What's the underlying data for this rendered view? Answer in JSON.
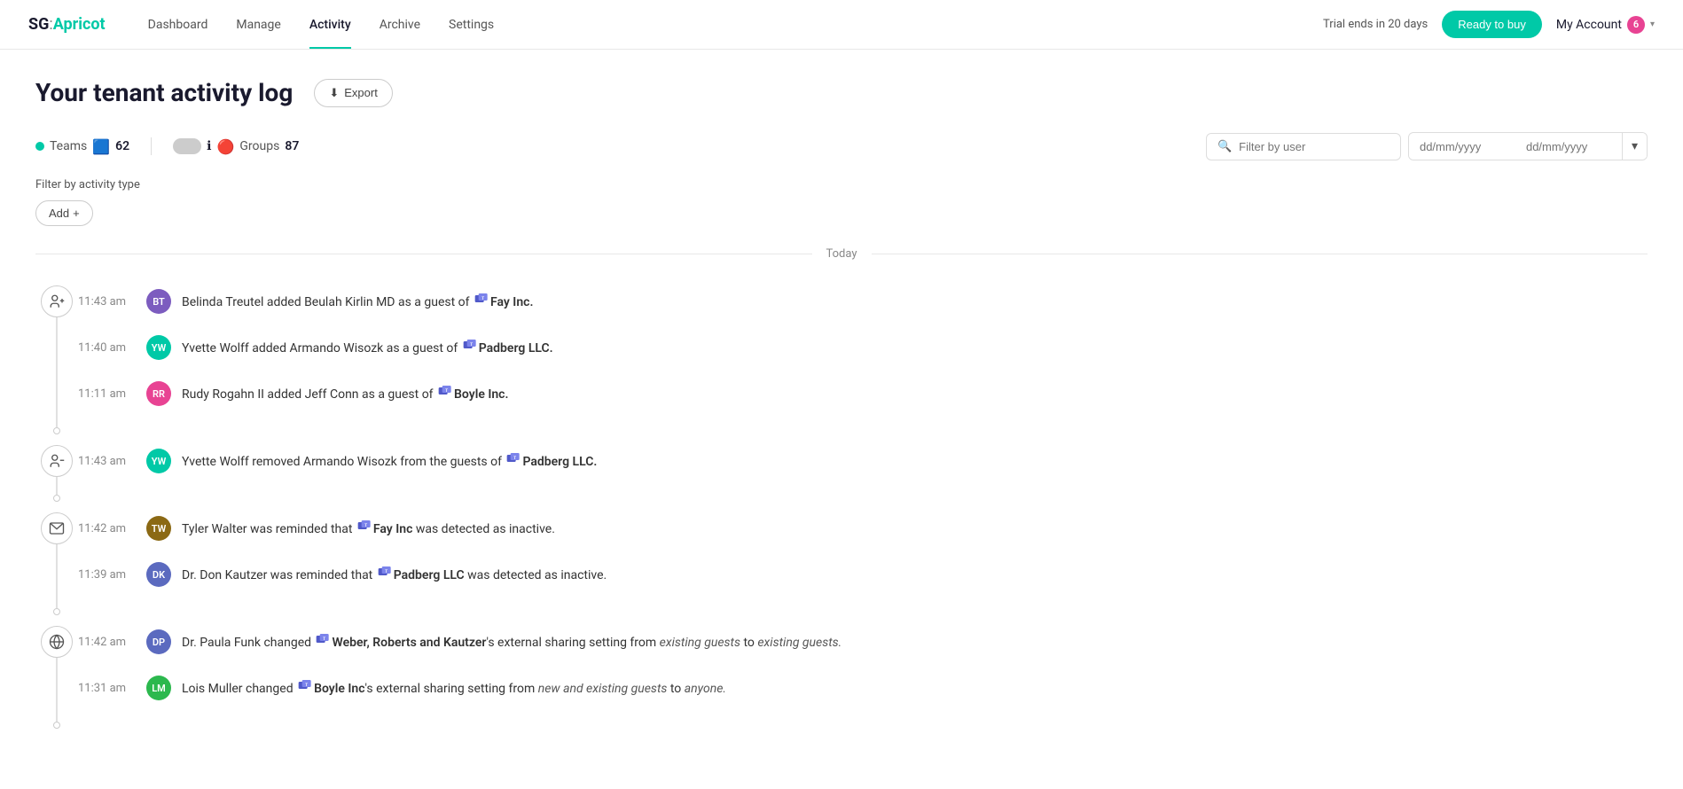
{
  "logo": {
    "sg": "SG",
    "colon": ":",
    "apricot": "Apricot"
  },
  "nav": {
    "links": [
      {
        "id": "dashboard",
        "label": "Dashboard",
        "active": false
      },
      {
        "id": "manage",
        "label": "Manage",
        "active": false
      },
      {
        "id": "activity",
        "label": "Activity",
        "active": true
      },
      {
        "id": "archive",
        "label": "Archive",
        "active": false
      },
      {
        "id": "settings",
        "label": "Settings",
        "active": false
      }
    ],
    "trial_text": "Trial ends in 20 days",
    "ready_btn": "Ready to buy",
    "my_account": "My Account",
    "account_badge": "6"
  },
  "page": {
    "title": "Your tenant activity log",
    "export_btn": "Export"
  },
  "filters": {
    "teams_label": "Teams",
    "teams_count": "62",
    "groups_label": "Groups",
    "groups_count": "87",
    "search_placeholder": "Filter by user",
    "date_from_placeholder": "dd/mm/yyyy",
    "date_to_placeholder": "dd/mm/yyyy"
  },
  "activity_filter": {
    "label": "Filter by activity type",
    "add_btn": "Add"
  },
  "today_label": "Today",
  "activity_groups": [
    {
      "type": "add-guest",
      "entries": [
        {
          "time": "11:43 am",
          "avatar_initials": "BT",
          "avatar_color": "#7c5cbf",
          "text_parts": [
            {
              "type": "plain",
              "text": "Belinda Treutel added Beulah Kirlin MD as a guest of "
            },
            {
              "type": "teams-icon"
            },
            {
              "type": "bold",
              "text": "Fay Inc."
            }
          ]
        },
        {
          "time": "11:40 am",
          "avatar_initials": "YW",
          "avatar_color": "#00c9a7",
          "text_parts": [
            {
              "type": "plain",
              "text": "Yvette Wolff added Armando Wisozk as a guest of "
            },
            {
              "type": "teams-icon"
            },
            {
              "type": "bold",
              "text": "Padberg LLC."
            }
          ]
        },
        {
          "time": "11:11 am",
          "avatar_initials": "RR",
          "avatar_color": "#e84393",
          "text_parts": [
            {
              "type": "plain",
              "text": "Rudy Rogahn II added Jeff Conn as a guest of "
            },
            {
              "type": "teams-icon"
            },
            {
              "type": "bold",
              "text": "Boyle Inc."
            }
          ]
        }
      ]
    },
    {
      "type": "remove-guest",
      "entries": [
        {
          "time": "11:43 am",
          "avatar_initials": "YW",
          "avatar_color": "#00c9a7",
          "text_parts": [
            {
              "type": "plain",
              "text": "Yvette Wolff removed Armando Wisozk from the guests of "
            },
            {
              "type": "teams-icon"
            },
            {
              "type": "bold",
              "text": "Padberg LLC."
            }
          ]
        }
      ]
    },
    {
      "type": "email",
      "entries": [
        {
          "time": "11:42 am",
          "avatar_initials": "TW",
          "avatar_color": "#8B6914",
          "avatar_img": true,
          "text_parts": [
            {
              "type": "plain",
              "text": "Tyler Walter was reminded that "
            },
            {
              "type": "teams-icon"
            },
            {
              "type": "bold",
              "text": "Fay Inc"
            },
            {
              "type": "plain",
              "text": " was detected as inactive."
            }
          ]
        },
        {
          "time": "11:39 am",
          "avatar_initials": "DK",
          "avatar_color": "#5b6abf",
          "text_parts": [
            {
              "type": "plain",
              "text": "Dr. Don Kautzer was reminded that "
            },
            {
              "type": "teams-icon"
            },
            {
              "type": "bold",
              "text": "Padberg LLC"
            },
            {
              "type": "plain",
              "text": " was detected as inactive."
            }
          ]
        }
      ]
    },
    {
      "type": "globe",
      "entries": [
        {
          "time": "11:42 am",
          "avatar_initials": "DP",
          "avatar_color": "#5b6abf",
          "text_parts": [
            {
              "type": "plain",
              "text": "Dr. Paula Funk changed "
            },
            {
              "type": "teams-icon"
            },
            {
              "type": "bold",
              "text": "Weber, Roberts and Kautzer"
            },
            {
              "type": "plain",
              "text": "'s external sharing setting from "
            },
            {
              "type": "italic",
              "text": "existing guests"
            },
            {
              "type": "plain",
              "text": " to "
            },
            {
              "type": "italic",
              "text": "existing guests."
            }
          ]
        },
        {
          "time": "11:31 am",
          "avatar_initials": "LM",
          "avatar_color": "#2cb84e",
          "text_parts": [
            {
              "type": "plain",
              "text": "Lois Muller changed "
            },
            {
              "type": "teams-icon"
            },
            {
              "type": "bold",
              "text": "Boyle Inc"
            },
            {
              "type": "italic2",
              "text": "'s external sharing setting from "
            },
            {
              "type": "italic",
              "text": "new and existing guests"
            },
            {
              "type": "plain",
              "text": " to "
            },
            {
              "type": "italic",
              "text": "anyone."
            }
          ]
        }
      ]
    }
  ]
}
